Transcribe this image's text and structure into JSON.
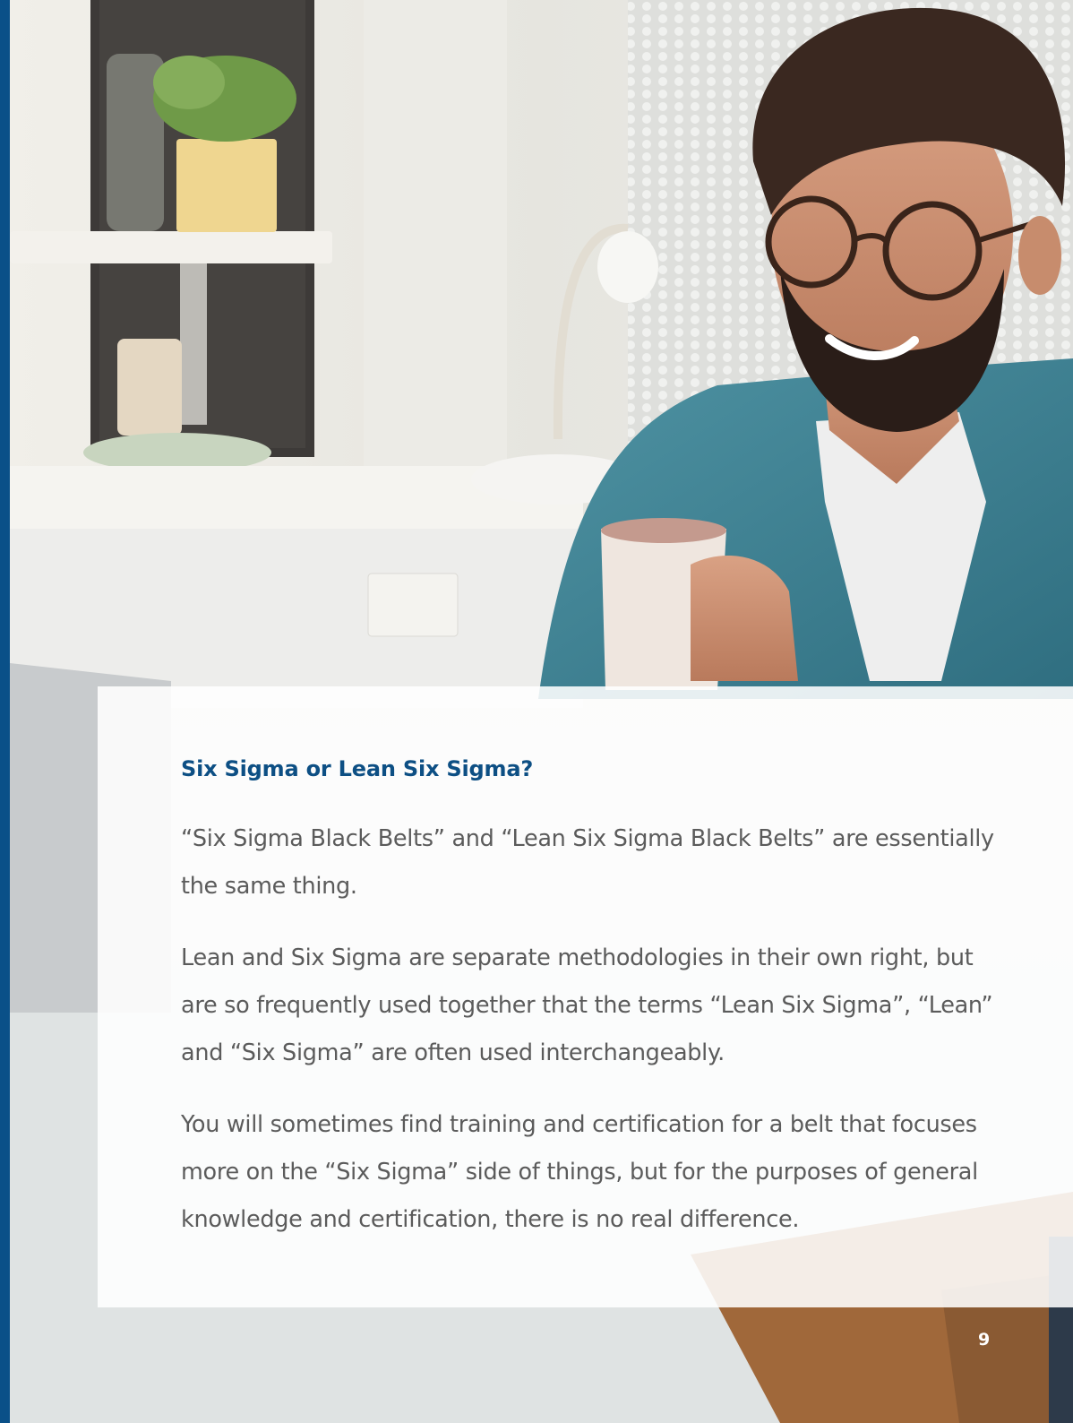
{
  "section": {
    "title": "Six Sigma or Lean Six Sigma?",
    "paragraphs": [
      "“Six Sigma Black Belts” and “Lean Six Sigma Black Belts” are essentially the same thing.",
      "Lean and Six Sigma are separate methodologies in their own right, but are so frequently used together that the terms “Lean Six Sigma”, “Lean” and “Six Sigma” are often used interchangeably.",
      "You will sometimes find training and certification for a belt that focuses more on the “Six Sigma” side of things, but for the purposes of general knowledge and certification, there is no real difference."
    ]
  },
  "footer": {
    "page_number": "9"
  },
  "colors": {
    "accent_blue": "#0a5088",
    "title_blue": "#0d4f84",
    "body_text": "#5b5b5b"
  }
}
